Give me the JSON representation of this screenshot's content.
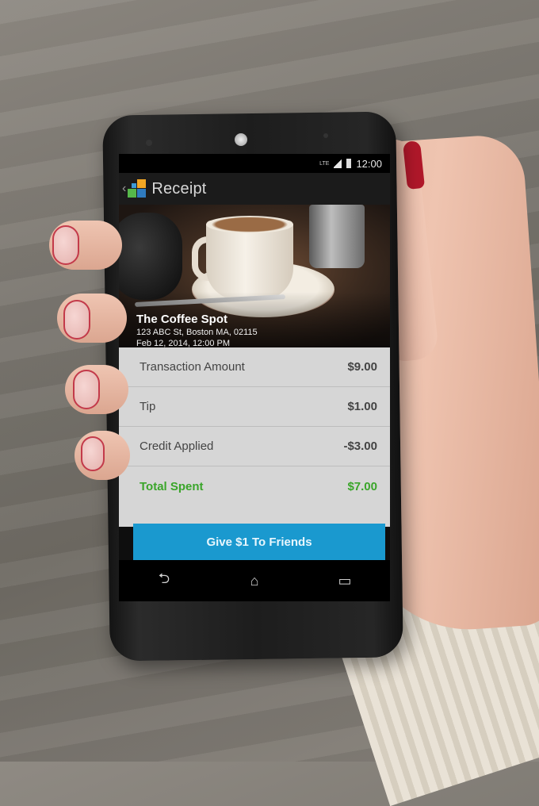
{
  "status_bar": {
    "network_label": "LTE",
    "time": "12:00"
  },
  "action_bar": {
    "title": "Receipt",
    "back_icon": "chevron-left-icon",
    "logo_colors": [
      "#3b9bd6",
      "#f2a724",
      "#56b84a",
      "#2f7bbf"
    ]
  },
  "merchant": {
    "name": "The Coffee Spot",
    "address": "123 ABC St, Boston MA, 02115",
    "datetime": "Feb 12, 2014, 12:00 PM"
  },
  "line_items": [
    {
      "label": "Transaction Amount",
      "amount": "$9.00"
    },
    {
      "label": "Tip",
      "amount": "$1.00"
    },
    {
      "label": "Credit Applied",
      "amount": "-$3.00"
    }
  ],
  "total": {
    "label": "Total Spent",
    "amount": "$7.00",
    "color": "#3aa52a"
  },
  "cta": {
    "label": "Give $1 To Friends",
    "color": "#1a99cf"
  },
  "nav_bar": {
    "icons": [
      "back-icon",
      "home-icon",
      "recent-apps-icon"
    ]
  }
}
